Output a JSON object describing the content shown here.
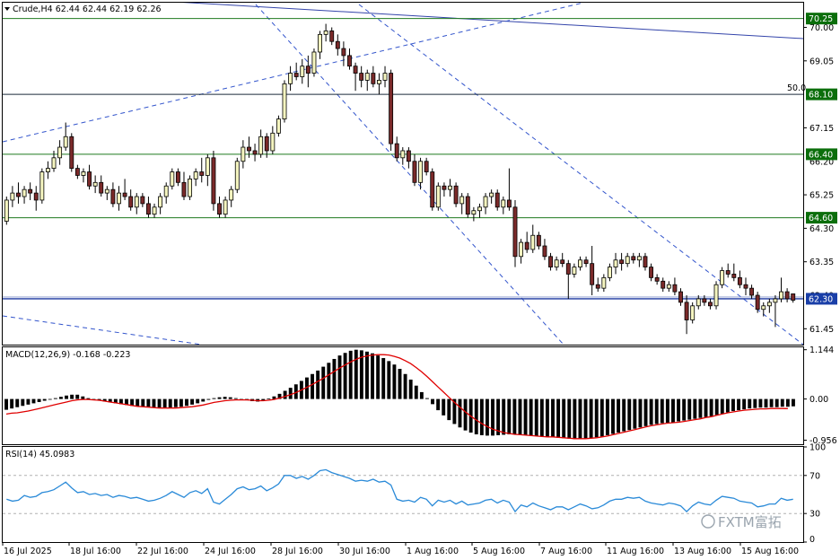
{
  "header": {
    "title": "Crude,H4",
    "ohlc": "62.44 62.44 62.19 62.26"
  },
  "watermark": "FXTM富拓",
  "colors": {
    "bull_candle": "#f5f5c0",
    "bear_candle": "#7b2a2a",
    "level_line": "#1f7a1f",
    "level_tag": "#0b6e0b",
    "current_line": "#1f3aa0",
    "current_tag": "#1a3fa8",
    "channel_line": "#3355cc",
    "fib_line": "#1a2a3a",
    "macd_hist": "#000000",
    "macd_signal": "#e00000",
    "rsi_line": "#2a8ad8"
  },
  "chart_data": [
    {
      "type": "candlestick",
      "title": "Crude,H4",
      "symbol": "Crude",
      "timeframe": "H4",
      "ylim": [
        61.0,
        70.7
      ],
      "y_ticks": [
        70.0,
        69.05,
        67.15,
        65.25,
        64.3,
        63.35,
        61.45
      ],
      "x_labels": [
        "16 Jul 2025",
        "18 Jul 16:00",
        "22 Jul 16:00",
        "24 Jul 16:00",
        "28 Jul 16:00",
        "30 Jul 16:00",
        "1 Aug 16:00",
        "5 Aug 16:00",
        "7 Aug 16:00",
        "11 Aug 16:00",
        "13 Aug 16:00",
        "15 Aug 16:00"
      ],
      "price_levels": [
        {
          "value": 70.25,
          "label": "70.25",
          "kind": "support_resistance"
        },
        {
          "value": 68.1,
          "label": "68.10",
          "kind": "fibonacci",
          "annotation": "50.0"
        },
        {
          "value": 66.4,
          "label": "66.40",
          "kind": "support_resistance"
        },
        {
          "value": 64.6,
          "label": "64.60",
          "kind": "support_resistance"
        },
        {
          "value": 62.3,
          "label": "62.30",
          "kind": "current"
        }
      ],
      "hidden_tick_labels": [
        "66.20",
        "62.40"
      ],
      "candles": [
        [
          64.5,
          65.2,
          64.4,
          65.1
        ],
        [
          65.1,
          65.5,
          64.9,
          65.3
        ],
        [
          65.3,
          65.6,
          65.0,
          65.2
        ],
        [
          65.2,
          65.5,
          65.0,
          65.4
        ],
        [
          65.4,
          65.6,
          65.1,
          65.3
        ],
        [
          65.3,
          65.5,
          64.8,
          65.1
        ],
        [
          65.1,
          66.0,
          65.0,
          65.9
        ],
        [
          65.9,
          66.2,
          65.7,
          66.0
        ],
        [
          66.0,
          66.5,
          65.9,
          66.3
        ],
        [
          66.3,
          66.8,
          66.1,
          66.6
        ],
        [
          66.6,
          67.3,
          66.5,
          66.9
        ],
        [
          66.9,
          67.0,
          65.9,
          66.0
        ],
        [
          66.0,
          66.1,
          65.7,
          65.8
        ],
        [
          65.8,
          66.0,
          65.6,
          65.9
        ],
        [
          65.9,
          66.1,
          65.4,
          65.5
        ],
        [
          65.5,
          65.8,
          65.3,
          65.6
        ],
        [
          65.6,
          65.8,
          65.2,
          65.3
        ],
        [
          65.3,
          65.5,
          65.1,
          65.4
        ],
        [
          65.4,
          65.6,
          64.9,
          65.0
        ],
        [
          65.0,
          65.5,
          64.8,
          65.3
        ],
        [
          65.3,
          65.7,
          65.1,
          65.2
        ],
        [
          65.2,
          65.4,
          64.8,
          64.9
        ],
        [
          64.9,
          65.3,
          64.7,
          65.2
        ],
        [
          65.2,
          65.3,
          64.9,
          65.0
        ],
        [
          65.0,
          65.2,
          64.6,
          64.7
        ],
        [
          64.7,
          65.0,
          64.6,
          64.9
        ],
        [
          64.9,
          65.3,
          64.7,
          65.2
        ],
        [
          65.2,
          65.6,
          65.0,
          65.5
        ],
        [
          65.5,
          66.0,
          65.4,
          65.9
        ],
        [
          65.9,
          66.0,
          65.5,
          65.6
        ],
        [
          65.6,
          65.9,
          65.1,
          65.2
        ],
        [
          65.2,
          65.8,
          65.1,
          65.7
        ],
        [
          65.7,
          66.0,
          65.5,
          65.9
        ],
        [
          65.9,
          66.3,
          65.6,
          65.8
        ],
        [
          65.8,
          66.4,
          65.5,
          66.3
        ],
        [
          66.3,
          66.5,
          64.8,
          65.0
        ],
        [
          65.0,
          65.2,
          64.6,
          64.7
        ],
        [
          64.7,
          65.2,
          64.6,
          65.1
        ],
        [
          65.1,
          65.5,
          64.9,
          65.4
        ],
        [
          65.4,
          66.3,
          65.3,
          66.2
        ],
        [
          66.2,
          66.8,
          66.0,
          66.6
        ],
        [
          66.6,
          66.9,
          66.3,
          66.5
        ],
        [
          66.5,
          66.7,
          66.2,
          66.4
        ],
        [
          66.4,
          67.1,
          66.3,
          66.9
        ],
        [
          66.9,
          67.0,
          66.3,
          66.5
        ],
        [
          66.5,
          67.2,
          66.4,
          67.0
        ],
        [
          67.0,
          67.5,
          66.9,
          67.4
        ],
        [
          67.4,
          68.5,
          67.3,
          68.4
        ],
        [
          68.4,
          68.9,
          68.2,
          68.7
        ],
        [
          68.7,
          69.0,
          68.5,
          68.6
        ],
        [
          68.6,
          69.1,
          68.4,
          68.9
        ],
        [
          68.9,
          69.2,
          68.3,
          68.7
        ],
        [
          68.7,
          69.4,
          68.6,
          69.3
        ],
        [
          69.3,
          69.9,
          69.1,
          69.8
        ],
        [
          69.8,
          70.1,
          69.6,
          69.9
        ],
        [
          69.9,
          70.0,
          69.5,
          69.6
        ],
        [
          69.6,
          69.8,
          69.2,
          69.4
        ],
        [
          69.4,
          69.6,
          68.9,
          69.2
        ],
        [
          69.2,
          69.4,
          68.8,
          68.9
        ],
        [
          68.9,
          69.0,
          68.2,
          68.7
        ],
        [
          68.7,
          68.9,
          68.3,
          68.5
        ],
        [
          68.5,
          68.8,
          68.2,
          68.7
        ],
        [
          68.7,
          68.9,
          68.3,
          68.4
        ],
        [
          68.4,
          68.7,
          68.1,
          68.5
        ],
        [
          68.5,
          68.9,
          68.3,
          68.7
        ],
        [
          68.7,
          68.8,
          66.5,
          66.7
        ],
        [
          66.7,
          66.9,
          66.2,
          66.3
        ],
        [
          66.3,
          66.6,
          66.1,
          66.5
        ],
        [
          66.5,
          66.6,
          66.0,
          66.2
        ],
        [
          66.2,
          66.4,
          65.5,
          65.6
        ],
        [
          65.6,
          66.3,
          65.4,
          66.2
        ],
        [
          66.2,
          66.3,
          65.8,
          65.9
        ],
        [
          65.9,
          66.0,
          64.8,
          64.9
        ],
        [
          64.9,
          65.6,
          64.8,
          65.5
        ],
        [
          65.5,
          65.6,
          65.2,
          65.4
        ],
        [
          65.4,
          65.7,
          65.2,
          65.5
        ],
        [
          65.5,
          65.6,
          64.9,
          65.0
        ],
        [
          65.0,
          65.3,
          64.7,
          65.2
        ],
        [
          65.2,
          65.3,
          64.6,
          64.7
        ],
        [
          64.7,
          64.9,
          64.5,
          64.8
        ],
        [
          64.8,
          65.0,
          64.6,
          64.9
        ],
        [
          64.9,
          65.3,
          64.7,
          65.2
        ],
        [
          65.2,
          65.4,
          65.0,
          65.3
        ],
        [
          65.3,
          65.4,
          64.8,
          64.9
        ],
        [
          64.9,
          65.2,
          64.7,
          65.1
        ],
        [
          65.1,
          66.0,
          64.8,
          64.9
        ],
        [
          64.9,
          65.1,
          63.2,
          63.5
        ],
        [
          63.5,
          64.0,
          63.3,
          63.9
        ],
        [
          63.9,
          64.2,
          63.6,
          63.7
        ],
        [
          63.7,
          64.4,
          63.6,
          64.1
        ],
        [
          64.1,
          64.2,
          63.7,
          63.8
        ],
        [
          63.8,
          64.0,
          63.4,
          63.5
        ],
        [
          63.5,
          63.6,
          63.1,
          63.2
        ],
        [
          63.2,
          63.5,
          63.1,
          63.4
        ],
        [
          63.4,
          63.6,
          63.2,
          63.3
        ],
        [
          63.3,
          63.4,
          62.3,
          63.0
        ],
        [
          63.0,
          63.3,
          62.9,
          63.2
        ],
        [
          63.2,
          63.5,
          63.1,
          63.4
        ],
        [
          63.4,
          63.5,
          63.2,
          63.3
        ],
        [
          63.3,
          63.8,
          62.4,
          62.7
        ],
        [
          62.7,
          62.9,
          62.5,
          62.6
        ],
        [
          62.6,
          63.0,
          62.5,
          62.9
        ],
        [
          62.9,
          63.3,
          62.8,
          63.2
        ],
        [
          63.2,
          63.6,
          63.0,
          63.4
        ],
        [
          63.4,
          63.6,
          63.1,
          63.3
        ],
        [
          63.3,
          63.6,
          63.2,
          63.5
        ],
        [
          63.5,
          63.6,
          63.3,
          63.4
        ],
        [
          63.4,
          63.6,
          63.2,
          63.5
        ],
        [
          63.5,
          63.6,
          63.1,
          63.2
        ],
        [
          63.2,
          63.3,
          62.8,
          62.9
        ],
        [
          62.9,
          63.0,
          62.7,
          62.8
        ],
        [
          62.8,
          62.9,
          62.5,
          62.6
        ],
        [
          62.6,
          62.8,
          62.5,
          62.7
        ],
        [
          62.7,
          62.9,
          62.4,
          62.5
        ],
        [
          62.5,
          62.6,
          62.1,
          62.2
        ],
        [
          62.2,
          62.4,
          61.3,
          61.7
        ],
        [
          61.7,
          62.2,
          61.6,
          62.1
        ],
        [
          62.1,
          62.4,
          62.0,
          62.3
        ],
        [
          62.3,
          62.4,
          62.1,
          62.2
        ],
        [
          62.2,
          62.3,
          62.0,
          62.1
        ],
        [
          62.1,
          62.8,
          62.0,
          62.7
        ],
        [
          62.7,
          63.2,
          62.6,
          63.1
        ],
        [
          63.1,
          63.3,
          62.9,
          63.0
        ],
        [
          63.0,
          63.3,
          62.8,
          62.9
        ],
        [
          62.9,
          63.1,
          62.6,
          62.7
        ],
        [
          62.7,
          62.9,
          62.4,
          62.6
        ],
        [
          62.6,
          62.7,
          62.3,
          62.4
        ],
        [
          62.4,
          62.5,
          61.9,
          62.0
        ],
        [
          62.0,
          62.2,
          61.8,
          62.1
        ],
        [
          62.1,
          62.3,
          61.9,
          62.2
        ],
        [
          62.2,
          62.4,
          61.5,
          62.3
        ],
        [
          62.3,
          62.9,
          62.2,
          62.5
        ],
        [
          62.5,
          62.6,
          62.2,
          62.3
        ],
        [
          62.44,
          62.44,
          62.19,
          62.26
        ]
      ]
    },
    {
      "type": "histogram",
      "title": "MACD(12,26,9)",
      "label": "MACD(12,26,9) -0.168 -0.223",
      "values_text": "-0.168 -0.223",
      "ylim": [
        -1.05,
        1.2
      ],
      "y_ticks": [
        1.144,
        0.0,
        -0.956
      ],
      "y_tick_labels": [
        "1.144",
        "0.00",
        "-0.956"
      ],
      "hist": [
        -0.25,
        -0.22,
        -0.19,
        -0.16,
        -0.13,
        -0.1,
        -0.07,
        -0.04,
        -0.01,
        0.02,
        0.05,
        0.08,
        0.1,
        0.1,
        0.06,
        0.02,
        -0.01,
        -0.04,
        -0.06,
        -0.08,
        -0.1,
        -0.12,
        -0.14,
        -0.16,
        -0.17,
        -0.18,
        -0.19,
        -0.2,
        -0.2,
        -0.2,
        -0.2,
        -0.19,
        -0.18,
        -0.16,
        -0.13,
        -0.1,
        -0.06,
        -0.02,
        0.02,
        0.04,
        0.05,
        0.04,
        0.02,
        -0.01,
        -0.03,
        -0.05,
        -0.06,
        -0.04,
        0.01,
        0.06,
        0.12,
        0.19,
        0.26,
        0.34,
        0.42,
        0.5,
        0.58,
        0.66,
        0.75,
        0.84,
        0.93,
        1.01,
        1.07,
        1.12,
        1.144,
        1.13,
        1.1,
        1.06,
        1.01,
        0.95,
        0.88,
        0.8,
        0.7,
        0.58,
        0.45,
        0.31,
        0.16,
        0.02,
        -0.12,
        -0.26,
        -0.38,
        -0.49,
        -0.58,
        -0.66,
        -0.73,
        -0.78,
        -0.82,
        -0.84,
        -0.85,
        -0.85,
        -0.84,
        -0.83,
        -0.82,
        -0.82,
        -0.83,
        -0.84,
        -0.85,
        -0.86,
        -0.87,
        -0.88,
        -0.89,
        -0.9,
        -0.91,
        -0.92,
        -0.93,
        -0.93,
        -0.92,
        -0.91,
        -0.89,
        -0.87,
        -0.84,
        -0.81,
        -0.78,
        -0.75,
        -0.72,
        -0.69,
        -0.66,
        -0.63,
        -0.6,
        -0.58,
        -0.56,
        -0.55,
        -0.54,
        -0.52,
        -0.5,
        -0.48,
        -0.46,
        -0.44,
        -0.42,
        -0.4,
        -0.37,
        -0.34,
        -0.31,
        -0.28,
        -0.26,
        -0.24,
        -0.22,
        -0.21,
        -0.2,
        -0.2,
        -0.19,
        -0.19,
        -0.18,
        -0.18,
        -0.17
      ],
      "signal": [
        -0.35,
        -0.33,
        -0.32,
        -0.3,
        -0.28,
        -0.25,
        -0.22,
        -0.19,
        -0.16,
        -0.13,
        -0.1,
        -0.07,
        -0.04,
        -0.02,
        -0.01,
        -0.01,
        -0.02,
        -0.03,
        -0.05,
        -0.07,
        -0.09,
        -0.11,
        -0.13,
        -0.15,
        -0.17,
        -0.18,
        -0.19,
        -0.2,
        -0.21,
        -0.21,
        -0.21,
        -0.21,
        -0.2,
        -0.19,
        -0.18,
        -0.16,
        -0.14,
        -0.11,
        -0.08,
        -0.06,
        -0.04,
        -0.03,
        -0.02,
        -0.02,
        -0.02,
        -0.03,
        -0.04,
        -0.04,
        -0.03,
        -0.01,
        0.02,
        0.06,
        0.1,
        0.15,
        0.21,
        0.27,
        0.34,
        0.41,
        0.48,
        0.56,
        0.64,
        0.72,
        0.79,
        0.86,
        0.92,
        0.97,
        1.0,
        1.02,
        1.03,
        1.03,
        1.02,
        0.99,
        0.95,
        0.89,
        0.82,
        0.73,
        0.63,
        0.52,
        0.4,
        0.28,
        0.16,
        0.04,
        -0.08,
        -0.19,
        -0.3,
        -0.4,
        -0.49,
        -0.57,
        -0.64,
        -0.7,
        -0.74,
        -0.78,
        -0.8,
        -0.82,
        -0.83,
        -0.84,
        -0.85,
        -0.86,
        -0.87,
        -0.88,
        -0.88,
        -0.89,
        -0.9,
        -0.91,
        -0.92,
        -0.92,
        -0.92,
        -0.91,
        -0.9,
        -0.88,
        -0.86,
        -0.83,
        -0.8,
        -0.77,
        -0.74,
        -0.71,
        -0.68,
        -0.65,
        -0.62,
        -0.6,
        -0.58,
        -0.56,
        -0.55,
        -0.54,
        -0.52,
        -0.5,
        -0.48,
        -0.46,
        -0.43,
        -0.41,
        -0.38,
        -0.35,
        -0.32,
        -0.3,
        -0.28,
        -0.26,
        -0.25,
        -0.24,
        -0.23,
        -0.23,
        -0.22,
        -0.22,
        -0.22,
        -0.223
      ]
    },
    {
      "type": "line",
      "title": "RSI(14)",
      "label": "RSI(14) 45.0983",
      "values_text": "45.0983",
      "ylim": [
        0,
        100
      ],
      "y_ticks": [
        100,
        70,
        30,
        0
      ],
      "y_tick_labels": [
        "100",
        "70",
        "30",
        "0"
      ],
      "levels": [
        70,
        30
      ],
      "values": [
        45,
        43,
        44,
        49,
        47,
        48,
        52,
        53,
        55,
        59,
        63,
        57,
        52,
        53,
        50,
        51,
        49,
        50,
        47,
        49,
        48,
        46,
        47,
        45,
        43,
        44,
        46,
        49,
        53,
        50,
        47,
        52,
        54,
        51,
        56,
        42,
        40,
        45,
        50,
        56,
        58,
        55,
        56,
        59,
        54,
        57,
        61,
        70,
        70,
        67,
        69,
        66,
        70,
        75,
        76,
        73,
        71,
        69,
        67,
        64,
        65,
        64,
        66,
        63,
        64,
        60,
        45,
        43,
        44,
        42,
        47,
        45,
        38,
        44,
        42,
        44,
        40,
        43,
        39,
        40,
        41,
        44,
        45,
        41,
        44,
        42,
        32,
        39,
        37,
        41,
        38,
        36,
        34,
        37,
        37,
        34,
        37,
        40,
        38,
        35,
        36,
        39,
        43,
        45,
        45,
        47,
        46,
        47,
        43,
        41,
        40,
        39,
        41,
        40,
        38,
        32,
        38,
        42,
        40,
        39,
        44,
        48,
        47,
        46,
        43,
        42,
        41,
        37,
        38,
        40,
        40,
        46,
        44,
        45
      ]
    }
  ]
}
